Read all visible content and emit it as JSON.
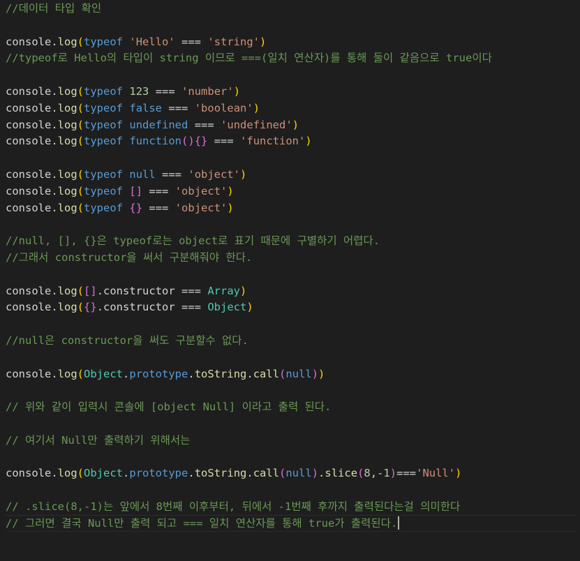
{
  "editor": {
    "lines": [
      [
        {
          "t": "//데이터 타입 확인",
          "c": "comment"
        }
      ],
      [],
      [
        {
          "t": "console",
          "c": "default"
        },
        {
          "t": ".",
          "c": "default"
        },
        {
          "t": "log",
          "c": "func"
        },
        {
          "t": "(",
          "c": "brace1"
        },
        {
          "t": "typeof",
          "c": "keyword"
        },
        {
          "t": " ",
          "c": "default"
        },
        {
          "t": "'Hello'",
          "c": "string"
        },
        {
          "t": " === ",
          "c": "default"
        },
        {
          "t": "'string'",
          "c": "string"
        },
        {
          "t": ")",
          "c": "brace1"
        }
      ],
      [
        {
          "t": "//typeof로 Hello의 타입이 string 이므로 ===(일치 연산자)를 통해 둘이 같음으로 true이다",
          "c": "comment"
        }
      ],
      [],
      [
        {
          "t": "console",
          "c": "default"
        },
        {
          "t": ".",
          "c": "default"
        },
        {
          "t": "log",
          "c": "func"
        },
        {
          "t": "(",
          "c": "brace1"
        },
        {
          "t": "typeof",
          "c": "keyword"
        },
        {
          "t": " ",
          "c": "default"
        },
        {
          "t": "123",
          "c": "number"
        },
        {
          "t": " === ",
          "c": "default"
        },
        {
          "t": "'number'",
          "c": "string"
        },
        {
          "t": ")",
          "c": "brace1"
        }
      ],
      [
        {
          "t": "console",
          "c": "default"
        },
        {
          "t": ".",
          "c": "default"
        },
        {
          "t": "log",
          "c": "func"
        },
        {
          "t": "(",
          "c": "brace1"
        },
        {
          "t": "typeof",
          "c": "keyword"
        },
        {
          "t": " ",
          "c": "default"
        },
        {
          "t": "false",
          "c": "keyword"
        },
        {
          "t": " === ",
          "c": "default"
        },
        {
          "t": "'boolean'",
          "c": "string"
        },
        {
          "t": ")",
          "c": "brace1"
        }
      ],
      [
        {
          "t": "console",
          "c": "default"
        },
        {
          "t": ".",
          "c": "default"
        },
        {
          "t": "log",
          "c": "func"
        },
        {
          "t": "(",
          "c": "brace1"
        },
        {
          "t": "typeof",
          "c": "keyword"
        },
        {
          "t": " ",
          "c": "default"
        },
        {
          "t": "undefined",
          "c": "keyword"
        },
        {
          "t": " === ",
          "c": "default"
        },
        {
          "t": "'undefined'",
          "c": "string"
        },
        {
          "t": ")",
          "c": "brace1"
        }
      ],
      [
        {
          "t": "console",
          "c": "default"
        },
        {
          "t": ".",
          "c": "default"
        },
        {
          "t": "log",
          "c": "func"
        },
        {
          "t": "(",
          "c": "brace1"
        },
        {
          "t": "typeof",
          "c": "keyword"
        },
        {
          "t": " ",
          "c": "default"
        },
        {
          "t": "function",
          "c": "keyword"
        },
        {
          "t": "()",
          "c": "brace2"
        },
        {
          "t": "{}",
          "c": "brace2"
        },
        {
          "t": " === ",
          "c": "default"
        },
        {
          "t": "'function'",
          "c": "string"
        },
        {
          "t": ")",
          "c": "brace1"
        }
      ],
      [],
      [
        {
          "t": "console",
          "c": "default"
        },
        {
          "t": ".",
          "c": "default"
        },
        {
          "t": "log",
          "c": "func"
        },
        {
          "t": "(",
          "c": "brace1"
        },
        {
          "t": "typeof",
          "c": "keyword"
        },
        {
          "t": " ",
          "c": "default"
        },
        {
          "t": "null",
          "c": "keyword"
        },
        {
          "t": " === ",
          "c": "default"
        },
        {
          "t": "'object'",
          "c": "string"
        },
        {
          "t": ")",
          "c": "brace1"
        }
      ],
      [
        {
          "t": "console",
          "c": "default"
        },
        {
          "t": ".",
          "c": "default"
        },
        {
          "t": "log",
          "c": "func"
        },
        {
          "t": "(",
          "c": "brace1"
        },
        {
          "t": "typeof",
          "c": "keyword"
        },
        {
          "t": " ",
          "c": "default"
        },
        {
          "t": "[]",
          "c": "brace2"
        },
        {
          "t": " === ",
          "c": "default"
        },
        {
          "t": "'object'",
          "c": "string"
        },
        {
          "t": ")",
          "c": "brace1"
        }
      ],
      [
        {
          "t": "console",
          "c": "default"
        },
        {
          "t": ".",
          "c": "default"
        },
        {
          "t": "log",
          "c": "func"
        },
        {
          "t": "(",
          "c": "brace1"
        },
        {
          "t": "typeof",
          "c": "keyword"
        },
        {
          "t": " ",
          "c": "default"
        },
        {
          "t": "{}",
          "c": "brace2"
        },
        {
          "t": " === ",
          "c": "default"
        },
        {
          "t": "'object'",
          "c": "string"
        },
        {
          "t": ")",
          "c": "brace1"
        }
      ],
      [],
      [
        {
          "t": "//null, [], {}은 typeof로는 object로 표기 때문에 구별하기 어렵다.",
          "c": "comment"
        }
      ],
      [
        {
          "t": "//그래서 constructor을 써서 구분해줘야 한다.",
          "c": "comment"
        }
      ],
      [],
      [
        {
          "t": "console",
          "c": "default"
        },
        {
          "t": ".",
          "c": "default"
        },
        {
          "t": "log",
          "c": "func"
        },
        {
          "t": "(",
          "c": "brace1"
        },
        {
          "t": "[]",
          "c": "brace2"
        },
        {
          "t": ".constructor",
          "c": "default"
        },
        {
          "t": " === ",
          "c": "default"
        },
        {
          "t": "Array",
          "c": "class"
        },
        {
          "t": ")",
          "c": "brace1"
        }
      ],
      [
        {
          "t": "console",
          "c": "default"
        },
        {
          "t": ".",
          "c": "default"
        },
        {
          "t": "log",
          "c": "func"
        },
        {
          "t": "(",
          "c": "brace1"
        },
        {
          "t": "{}",
          "c": "brace2"
        },
        {
          "t": ".constructor",
          "c": "default"
        },
        {
          "t": " === ",
          "c": "default"
        },
        {
          "t": "Object",
          "c": "class"
        },
        {
          "t": ")",
          "c": "brace1"
        }
      ],
      [],
      [
        {
          "t": "//null은 constructor을 써도 구분할수 없다.",
          "c": "comment"
        }
      ],
      [],
      [
        {
          "t": "console",
          "c": "default"
        },
        {
          "t": ".",
          "c": "default"
        },
        {
          "t": "log",
          "c": "func"
        },
        {
          "t": "(",
          "c": "brace1"
        },
        {
          "t": "Object",
          "c": "class"
        },
        {
          "t": ".",
          "c": "default"
        },
        {
          "t": "prototype",
          "c": "keyword"
        },
        {
          "t": ".",
          "c": "default"
        },
        {
          "t": "toString",
          "c": "func"
        },
        {
          "t": ".",
          "c": "default"
        },
        {
          "t": "call",
          "c": "func"
        },
        {
          "t": "(",
          "c": "brace2"
        },
        {
          "t": "null",
          "c": "keyword"
        },
        {
          "t": ")",
          "c": "brace2"
        },
        {
          "t": ")",
          "c": "brace1"
        }
      ],
      [],
      [
        {
          "t": "// 위와 같이 입력시 콘솔에 [object Null] 이라고 출력 된다.",
          "c": "comment"
        }
      ],
      [],
      [
        {
          "t": "// 여기서 Null만 출력하기 위해서는",
          "c": "comment"
        }
      ],
      [],
      [
        {
          "t": "console",
          "c": "default"
        },
        {
          "t": ".",
          "c": "default"
        },
        {
          "t": "log",
          "c": "func"
        },
        {
          "t": "(",
          "c": "brace1"
        },
        {
          "t": "Object",
          "c": "class"
        },
        {
          "t": ".",
          "c": "default"
        },
        {
          "t": "prototype",
          "c": "keyword"
        },
        {
          "t": ".",
          "c": "default"
        },
        {
          "t": "toString",
          "c": "func"
        },
        {
          "t": ".",
          "c": "default"
        },
        {
          "t": "call",
          "c": "func"
        },
        {
          "t": "(",
          "c": "brace2"
        },
        {
          "t": "null",
          "c": "keyword"
        },
        {
          "t": ")",
          "c": "brace2"
        },
        {
          "t": ".",
          "c": "default"
        },
        {
          "t": "slice",
          "c": "func"
        },
        {
          "t": "(",
          "c": "brace2"
        },
        {
          "t": "8",
          "c": "number"
        },
        {
          "t": ",",
          "c": "default"
        },
        {
          "t": "-1",
          "c": "number"
        },
        {
          "t": ")",
          "c": "brace2"
        },
        {
          "t": "===",
          "c": "default"
        },
        {
          "t": "'Null'",
          "c": "string"
        },
        {
          "t": ")",
          "c": "brace1"
        }
      ],
      [],
      [
        {
          "t": "// .slice(8,-1)는 앞에서 8번째 이후부터, 뒤에서 -1번째 후까지 출력된다는걸 의미한다",
          "c": "comment"
        }
      ],
      [
        {
          "t": "// 그러면 결국 Null만 출력 되고 === 일치 연산자를 통해 true가 출력된다.",
          "c": "comment"
        }
      ]
    ],
    "active_line": 31
  },
  "colors": {
    "background": "#1e1e1e",
    "comment": "#6a9955",
    "default": "#d4d4d4",
    "func": "#dcdcaa",
    "keyword": "#569cd6",
    "string": "#ce9178",
    "number": "#b5cea8",
    "class": "#4ec9b0",
    "brace1": "#ffd700",
    "brace2": "#da70d6"
  }
}
